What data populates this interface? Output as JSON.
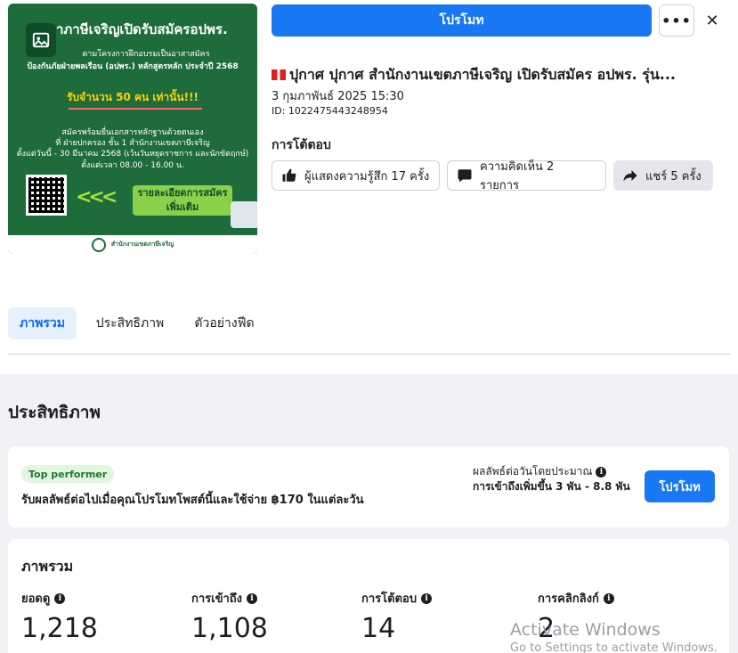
{
  "post_image": {
    "headline": "าภาษีเจริญเปิดรับสมัครอปพร.",
    "sub1": "ตามโครงการฝึกอบรมเป็นอาสาสมัคร",
    "sub2": "ป้องกันภัยฝ่ายพลเรือน (อปพร.) หลักสูตรหลัก ประจำปี 2568",
    "quota": "รับจำนวน 50 คน เท่านั้น!!!",
    "info1": "สมัครพร้อมยื่นเอกสารหลักฐานด้วยตนเอง",
    "info2": "ที่ ฝ่ายปกครอง ชั้น 1 สำนักงานเขตภาษีเจริญ",
    "info3": "ตั้งแต่วันนี้ - 30 มีนาคม 2568 (เว้นวันหยุดราชการ และนักขัตฤกษ์)",
    "info4": "ตั้งแต่เวลา 08.00 - 16.00 น.",
    "arrows": "<<<",
    "details_button": "รายละเอียดการสมัคร เพิ่มเติม",
    "footer_org": "สำนักงานเขตภาษีเจริญ",
    "gallery_icon": "gallery-icon"
  },
  "header": {
    "promote_label": "โปรโมท",
    "more_label": "•••",
    "close_label": "✕"
  },
  "post": {
    "title": "ปุกาศ ปุกาศ สำนักงานเขตภาษีเจริญ เปิดรับสมัคร อปพร. รุ่น...",
    "date": "3 กุมภาพันธ์ 2025 15:30",
    "id": "ID: 1022475443248954"
  },
  "interactions": {
    "heading": "การโต้ตอบ",
    "reactions": "ผู้แสดงความรู้สึก 17 ครั้ง",
    "comments": "ความคิดเห็น 2 รายการ",
    "shares": "แชร์ 5 ครั้ง"
  },
  "tabs": [
    {
      "label": "ภาพรวม",
      "active": true
    },
    {
      "label": "ประสิทธิภาพ",
      "active": false
    },
    {
      "label": "ตัวอย่างฟีด",
      "active": false
    }
  ],
  "performance": {
    "title": "ประสิทธิภาพ",
    "badge": "Top performer",
    "description": "รับผลลัพธ์ต่อไปเมื่อคุณโปรโมทโพสต์นี้และใช้จ่าย ฿170 ในแต่ละวัน",
    "estimate_label": "ผลลัพธ์ต่อวันโดยประมาณ",
    "estimate_value": "การเข้าถึงเพิ่มขึ้น 3 พัน - 8.8 พัน",
    "promote_label": "โปรโมท"
  },
  "overview": {
    "title": "ภาพรวม",
    "metrics": [
      {
        "label": "ยอดดู",
        "value": "1,218"
      },
      {
        "label": "การเข้าถึง",
        "value": "1,108"
      },
      {
        "label": "การโต้ตอบ",
        "value": "14"
      },
      {
        "label": "การคลิกลิงก์",
        "value": "2"
      }
    ]
  },
  "watermark": {
    "line1": "Activate Windows",
    "line2": "Go to Settings to activate Windows."
  },
  "colors": {
    "accent": "#1877f2",
    "poster_green": "#1e6b3c",
    "badge_green": "#1e7a34"
  }
}
